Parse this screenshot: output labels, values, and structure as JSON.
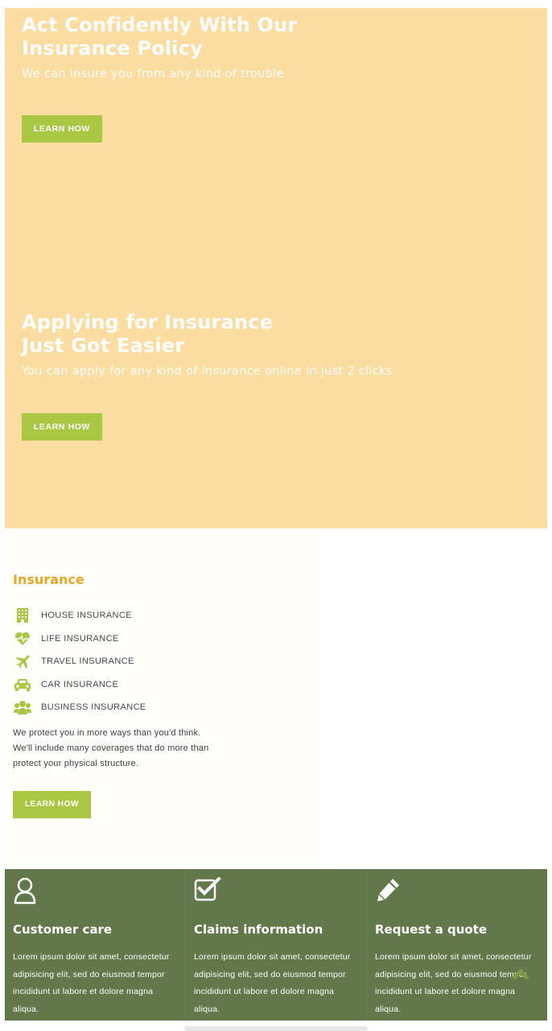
{
  "hero": {
    "slides": [
      {
        "title_line1": "Act Confidently With Our",
        "title_line2": "Insurance Policy",
        "subtitle": "We can insure you from any kind of trouble",
        "button_label": "LEARN HOW"
      },
      {
        "title_line1": "Applying for Insurance",
        "title_line2": "Just Got Easier",
        "subtitle": "You can apply for any kind of insurance online in just 2 clicks",
        "button_label": "LEARN HOW"
      }
    ],
    "background_color": "#fbdca1"
  },
  "insurance": {
    "title": "Insurance",
    "items": [
      {
        "icon": "building-icon",
        "label": "HOUSE INSURANCE"
      },
      {
        "icon": "heart-pulse-icon",
        "label": "LIFE INSURANCE"
      },
      {
        "icon": "plane-icon",
        "label": "TRAVEL INSURANCE"
      },
      {
        "icon": "car-icon",
        "label": "CAR INSURANCE"
      },
      {
        "icon": "users-icon",
        "label": "BUSINESS INSURANCE"
      }
    ],
    "description_line1": "We protect you in more ways than you'd think.",
    "description_line2": "We'll include many coverages that do more than",
    "description_line3": "protect your physical structure.",
    "button_label": "LEARN HOW",
    "accent_color": "#e9a726",
    "icon_color": "#a9c743"
  },
  "features": [
    {
      "icon": "user-icon",
      "title": "Customer care",
      "text": "Lorem ipsum dolor sit amet, consectetur adipisicing elit, sed do eiusmod tempor incididunt ut labore et dolore magna aliqua."
    },
    {
      "icon": "checkbox-icon",
      "title": "Claims information",
      "text": "Lorem ipsum dolor sit amet, consectetur adipisicing elit, sed do eiusmod tempor incididunt ut labore et dolore magna aliqua."
    },
    {
      "icon": "pencil-icon",
      "title": "Request a quote",
      "text": "Lorem ipsum dolor sit amet, consectetur adipisicing elit, sed do eiusmod tempor incididunt ut labore et dolore magna aliqua."
    }
  ],
  "colors": {
    "button": "#a9c743",
    "features_bg": "#62774a"
  },
  "scroll_top_icon": "chevron-up-icon"
}
